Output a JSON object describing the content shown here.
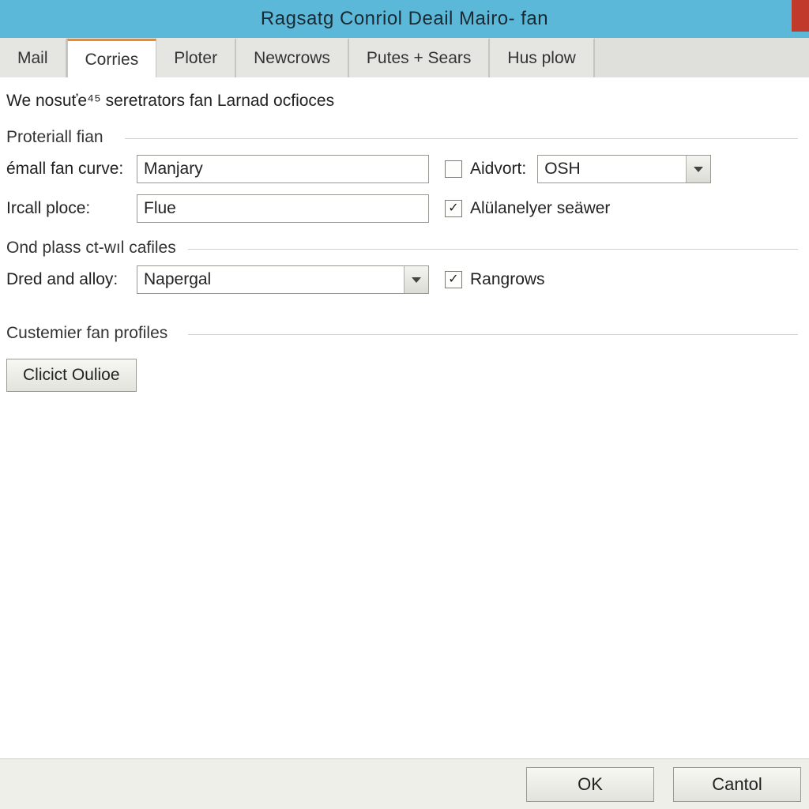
{
  "window": {
    "title": "Ragsatg Conriol Deail Mairo- fan"
  },
  "tabs": [
    {
      "label": "Mail"
    },
    {
      "label": "Corries",
      "active": true
    },
    {
      "label": "Ploter"
    },
    {
      "label": "Newcrows"
    },
    {
      "label": "Putes + Sears"
    },
    {
      "label": "Hus plow"
    }
  ],
  "content": {
    "heading": "We nosuťe⁴⁵ seretrators fan Larnad ocfioces",
    "section1": {
      "title": "Proteriall fian",
      "field1_label": "émall fan curve:",
      "field1_value": "Manjary",
      "check1_label": "Aidvort:",
      "check1_checked": false,
      "combo1_value": "OSH",
      "field2_label": "Ircall ploce:",
      "field2_value": "Flue",
      "check2_label": "Alülanelyer seäwer",
      "check2_checked": true
    },
    "section2": {
      "title": "Ond plass ct-wıl cafiles",
      "field_label": "Dred and alloy:",
      "combo_value": "Napergal",
      "check_label": "Rangrows",
      "check_checked": true
    },
    "section3": {
      "title": "Custemier fan profiles",
      "button_label": "Clicict Oulioe"
    }
  },
  "footer": {
    "ok": "OK",
    "cancel": "Cantol"
  }
}
